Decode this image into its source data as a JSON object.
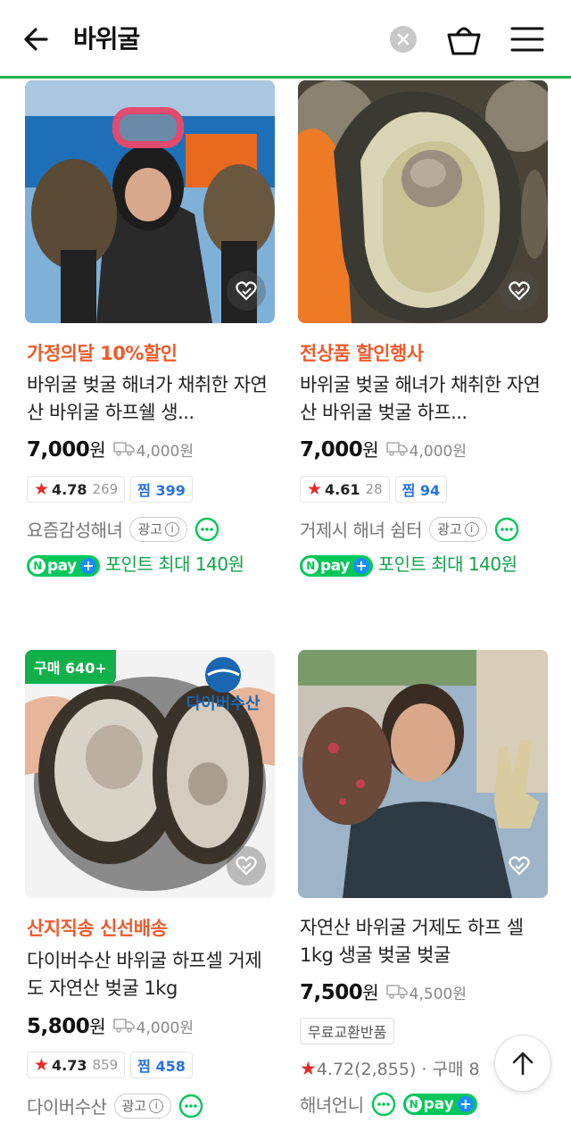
{
  "header": {
    "search_query": "바위굴",
    "icons": [
      "back-arrow-icon",
      "clear-icon",
      "shopping-bag-icon",
      "hamburger-menu-icon"
    ]
  },
  "colors": {
    "accent": "#22b04b",
    "promo": "#f05a2a",
    "npay": "#03c75a",
    "zzim": "#2872e4",
    "star": "#e52a2a"
  },
  "products": [
    {
      "promo": "가정의달 10%할인",
      "title": "바위굴 벚굴 해녀가 채취한 자연산 바위굴 하프쉘 생...",
      "price": "7,000",
      "won": "원",
      "shipping": "4,000원",
      "rating": "4.78",
      "review_count": "269",
      "zzim": "찜 399",
      "seller": "요즘감성해녀",
      "ad_label": "광고",
      "npay_text": "포인트 최대 140원"
    },
    {
      "promo": "전상품 할인행사",
      "title": "바위굴 벚굴 해녀가 채취한 자연산 바위굴 벚굴 하프...",
      "price": "7,000",
      "won": "원",
      "shipping": "4,000원",
      "rating": "4.61",
      "review_count": "28",
      "zzim": "찜 94",
      "seller": "거제시 해녀 쉼터",
      "ad_label": "광고",
      "npay_text": "포인트 최대 140원"
    },
    {
      "badge": "구매 640+",
      "promo": "산지직송 신선배송",
      "title": "다이버수산 바위굴 하프셀 거제도 자연산 벚굴 1kg",
      "price": "5,800",
      "won": "원",
      "shipping": "4,000원",
      "rating": "4.73",
      "review_count": "859",
      "zzim": "찜 458",
      "seller": "다이버수산",
      "ad_label": "광고",
      "image_watermark": "다이버수산"
    },
    {
      "title": "자연산 바위굴 거제도 하프 셀 1kg 생굴 벚굴 벚굴",
      "price": "7,500",
      "won": "원",
      "shipping": "4,500원",
      "free_tag": "무료교환반품",
      "rating_line": "4.72(2,855)",
      "purchase_line": "구매 8",
      "seller": "해녀언니"
    }
  ],
  "npay_label": "pay",
  "scroll_top_icon": "arrow-up-icon"
}
